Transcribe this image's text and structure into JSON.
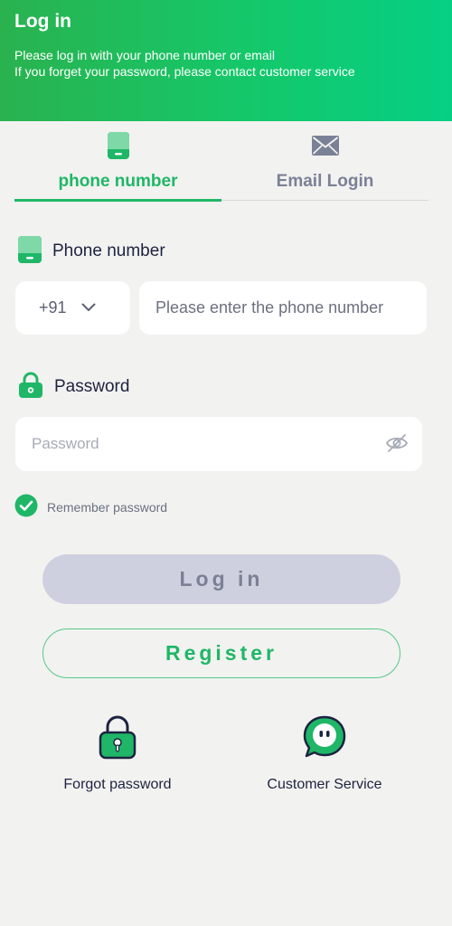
{
  "header": {
    "title": "Log in",
    "subtitle_line1": "Please log in with your phone number or email",
    "subtitle_line2": "If you forget your password, please contact customer service"
  },
  "tabs": [
    {
      "label": "phone number",
      "icon": "phone-icon",
      "active": true
    },
    {
      "label": "Email Login",
      "icon": "mail-icon",
      "active": false
    }
  ],
  "phone_field": {
    "label": "Phone number",
    "country_code": "+91",
    "placeholder": "Please enter the phone number",
    "value": ""
  },
  "password_field": {
    "label": "Password",
    "placeholder": "Password",
    "value": ""
  },
  "remember": {
    "label": "Remember password",
    "checked": true
  },
  "buttons": {
    "login": "Log in",
    "register": "Register"
  },
  "links": {
    "forgot": "Forgot password",
    "service": "Customer Service"
  },
  "colors": {
    "accent": "#1fb767",
    "header_gradient_start": "#2ab24f",
    "header_gradient_end": "#06cf84",
    "login_button_bg": "#cfd0df",
    "background": "#f2f2f0"
  }
}
